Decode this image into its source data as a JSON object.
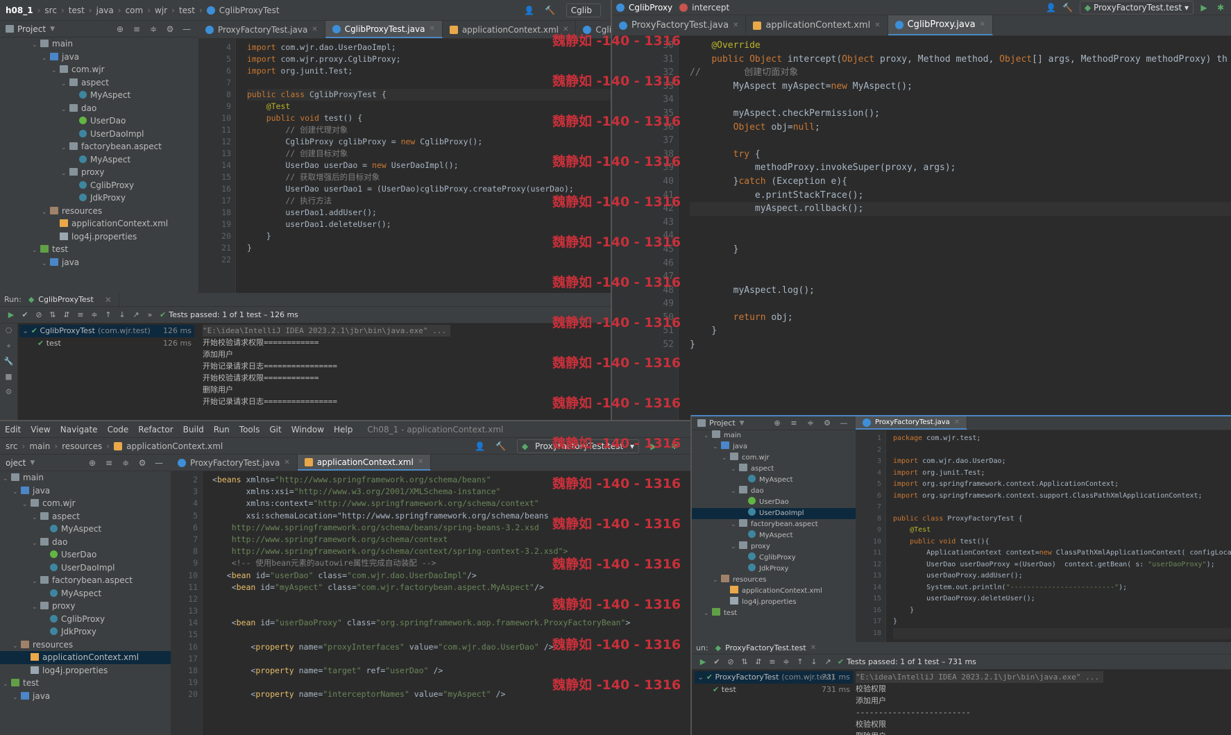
{
  "watermark": "魏静如 -140 - 1316",
  "pane_tl": {
    "breadcrumbs": [
      "h08_1",
      "src",
      "test",
      "java",
      "com",
      "wjr",
      "test",
      "CglibProxyTest"
    ],
    "run_config": "Cglib",
    "tabs": [
      {
        "label": "ProxyFactoryTest.java",
        "kind": "java",
        "active": false
      },
      {
        "label": "CglibProxyTest.java",
        "kind": "java",
        "active": true
      },
      {
        "label": "applicationContext.xml",
        "kind": "xml",
        "active": false
      },
      {
        "label": "CglibProxy.java",
        "kind": "java",
        "active": false
      }
    ],
    "tree_title": "Project",
    "tree": [
      {
        "label": "main",
        "depth": 3,
        "type": "folder",
        "open": true
      },
      {
        "label": "java",
        "depth": 4,
        "type": "src",
        "open": true
      },
      {
        "label": "com.wjr",
        "depth": 5,
        "type": "folder",
        "open": true
      },
      {
        "label": "aspect",
        "depth": 6,
        "type": "folder",
        "open": true
      },
      {
        "label": "MyAspect",
        "depth": 7,
        "type": "cls"
      },
      {
        "label": "dao",
        "depth": 6,
        "type": "folder",
        "open": true
      },
      {
        "label": "UserDao",
        "depth": 7,
        "type": "intf"
      },
      {
        "label": "UserDaoImpl",
        "depth": 7,
        "type": "cls"
      },
      {
        "label": "factorybean.aspect",
        "depth": 6,
        "type": "folder",
        "open": true
      },
      {
        "label": "MyAspect",
        "depth": 7,
        "type": "cls"
      },
      {
        "label": "proxy",
        "depth": 6,
        "type": "folder",
        "open": true
      },
      {
        "label": "CglibProxy",
        "depth": 7,
        "type": "cls"
      },
      {
        "label": "JdkProxy",
        "depth": 7,
        "type": "cls"
      },
      {
        "label": "resources",
        "depth": 4,
        "type": "res",
        "open": true
      },
      {
        "label": "applicationContext.xml",
        "depth": 5,
        "type": "xml"
      },
      {
        "label": "log4j.properties",
        "depth": 5,
        "type": "prop"
      },
      {
        "label": "test",
        "depth": 3,
        "type": "test",
        "open": true
      },
      {
        "label": "java",
        "depth": 4,
        "type": "src",
        "open": true
      }
    ],
    "line_numbers": [
      "4",
      "5",
      "6",
      "7",
      "8",
      "9",
      "10",
      "11",
      "12",
      "13",
      "14",
      "15",
      "16",
      "17",
      "18",
      "19",
      "20",
      "21",
      "22"
    ],
    "code": [
      "import com.wjr.dao.UserDaoImpl;",
      "import com.wjr.proxy.CglibProxy;",
      "import org.junit.Test;",
      "",
      "public class CglibProxyTest {",
      "    @Test",
      "    public void test() {",
      "        // 创建代理对象",
      "        CglibProxy cglibProxy = new CglibProxy();",
      "        // 创建目标对象",
      "        UserDao userDao = new UserDaoImpl();",
      "        // 获取增强后的目标对象",
      "        UserDao userDao1 = (UserDao)cglibProxy.createProxy(userDao);",
      "        // 执行方法",
      "        userDao1.addUser();",
      "        userDao1.deleteUser();",
      "    }",
      "}",
      ""
    ],
    "run": {
      "label": "Run:",
      "tab": "CglibProxyTest",
      "status": "Tests passed: 1 of 1 test – 126 ms",
      "tests": [
        {
          "label": "CglibProxyTest",
          "pkg": "(com.wjr.test)",
          "dur": "126 ms"
        },
        {
          "label": "test",
          "pkg": "",
          "dur": "126 ms"
        }
      ],
      "console": [
        "\"E:\\idea\\IntelliJ IDEA 2023.2.1\\jbr\\bin\\java.exe\" ...",
        "开始校验请求权限============",
        "添加用户",
        "开始记录请求日志================",
        "开始校验请求权限============",
        "删除用户",
        "开始记录请求日志================"
      ]
    }
  },
  "pane_tr": {
    "title": "CglibProxy",
    "method": "intercept",
    "run_config": "ProxyFactoryTest.test",
    "tabs": [
      {
        "label": "ProxyFactoryTest.java",
        "kind": "java",
        "active": false
      },
      {
        "label": "applicationContext.xml",
        "kind": "xml",
        "active": false
      },
      {
        "label": "CglibProxy.java",
        "kind": "java",
        "active": true
      }
    ],
    "line_numbers": [
      "30",
      "31",
      "32",
      "33",
      "34",
      "35",
      "36",
      "37",
      "38",
      "39",
      "40",
      "41",
      "42",
      "43",
      "44",
      "45",
      "46",
      "47",
      "48",
      "49",
      "50",
      "51",
      "52"
    ],
    "code": [
      "    @Override",
      "    public Object intercept(Object proxy, Method method, Object[] args, MethodProxy methodProxy) th",
      "//        创建切面对象",
      "        MyAspect myAspect=new MyAspect();",
      "",
      "        myAspect.checkPermission();",
      "        Object obj=null;",
      "",
      "        try {",
      "            methodProxy.invokeSuper(proxy, args);",
      "        }catch (Exception e){",
      "            e.printStackTrace();",
      "            myAspect.rollback();",
      "",
      "",
      "        }",
      "",
      "",
      "        myAspect.log();",
      "",
      "        return obj;",
      "    }",
      "}"
    ]
  },
  "pane_bl": {
    "menu": [
      "Edit",
      "View",
      "Navigate",
      "Code",
      "Refactor",
      "Build",
      "Run",
      "Tools",
      "Git",
      "Window",
      "Help"
    ],
    "project_title": "Ch08_1 - applicationContext.xml",
    "breadcrumbs": [
      "src",
      "main",
      "resources",
      "applicationContext.xml"
    ],
    "run_config": "ProxyFactoryTest.test",
    "tabs": [
      {
        "label": "ProxyFactoryTest.java",
        "kind": "java",
        "active": false
      },
      {
        "label": "applicationContext.xml",
        "kind": "xml",
        "active": true
      }
    ],
    "tree_title": "oject",
    "tree": [
      {
        "label": "main",
        "depth": 0,
        "type": "folder",
        "open": true
      },
      {
        "label": "java",
        "depth": 1,
        "type": "src",
        "open": true
      },
      {
        "label": "com.wjr",
        "depth": 2,
        "type": "folder",
        "open": true
      },
      {
        "label": "aspect",
        "depth": 3,
        "type": "folder",
        "open": true
      },
      {
        "label": "MyAspect",
        "depth": 4,
        "type": "cls"
      },
      {
        "label": "dao",
        "depth": 3,
        "type": "folder",
        "open": true
      },
      {
        "label": "UserDao",
        "depth": 4,
        "type": "intf"
      },
      {
        "label": "UserDaoImpl",
        "depth": 4,
        "type": "cls"
      },
      {
        "label": "factorybean.aspect",
        "depth": 3,
        "type": "folder",
        "open": true
      },
      {
        "label": "MyAspect",
        "depth": 4,
        "type": "cls"
      },
      {
        "label": "proxy",
        "depth": 3,
        "type": "folder",
        "open": true
      },
      {
        "label": "CglibProxy",
        "depth": 4,
        "type": "cls"
      },
      {
        "label": "JdkProxy",
        "depth": 4,
        "type": "cls"
      },
      {
        "label": "resources",
        "depth": 1,
        "type": "res",
        "open": true
      },
      {
        "label": "applicationContext.xml",
        "depth": 2,
        "type": "xml",
        "selected": true
      },
      {
        "label": "log4j.properties",
        "depth": 2,
        "type": "prop"
      },
      {
        "label": "test",
        "depth": 0,
        "type": "test",
        "open": true
      },
      {
        "label": "java",
        "depth": 1,
        "type": "src",
        "open": true
      }
    ],
    "line_numbers": [
      "2",
      "3",
      "4",
      "5",
      "6",
      "7",
      "8",
      "9",
      "10",
      "11",
      "12",
      "13",
      "14",
      "15",
      "16",
      "17",
      "18",
      "19",
      "20"
    ],
    "code": [
      "<beans xmlns=\"http://www.springframework.org/schema/beans\"",
      "       xmlns:xsi=\"http://www.w3.org/2001/XMLSchema-instance\"",
      "       xmlns:context=\"http://www.springframework.org/schema/context\"",
      "       xsi:schemaLocation=\"http://www.springframework.org/schema/beans",
      "    http://www.springframework.org/schema/beans/spring-beans-3.2.xsd",
      "    http://www.springframework.org/schema/context",
      "    http://www.springframework.org/schema/context/spring-context-3.2.xsd\">",
      "    <!-- 使用bean元素的autowire属性完成自动装配 -->",
      "   <bean id=\"userDao\" class=\"com.wjr.dao.UserDaoImpl\"/>",
      "    <bean id=\"myAspect\" class=\"com.wjr.factorybean.aspect.MyAspect\"/>",
      "",
      "",
      "    <bean id=\"userDaoProxy\" class=\"org.springframework.aop.framework.ProxyFactoryBean\">",
      "",
      "        <property name=\"proxyInterfaces\" value=\"com.wjr.dao.UserDao\" />",
      "",
      "        <property name=\"target\" ref=\"userDao\" />",
      "",
      "        <property name=\"interceptorNames\" value=\"myAspect\" />"
    ]
  },
  "pane_br": {
    "tree_title": "Project",
    "tabs": [
      {
        "label": "ProxyFactoryTest.java",
        "kind": "java",
        "active": true
      }
    ],
    "tree": [
      {
        "label": "main",
        "depth": 1,
        "type": "folder",
        "open": true
      },
      {
        "label": "java",
        "depth": 2,
        "type": "src",
        "open": true
      },
      {
        "label": "com.wjr",
        "depth": 3,
        "type": "folder",
        "open": true
      },
      {
        "label": "aspect",
        "depth": 4,
        "type": "folder",
        "open": true
      },
      {
        "label": "MyAspect",
        "depth": 5,
        "type": "cls"
      },
      {
        "label": "dao",
        "depth": 4,
        "type": "folder",
        "open": true
      },
      {
        "label": "UserDao",
        "depth": 5,
        "type": "intf"
      },
      {
        "label": "UserDaoImpl",
        "depth": 5,
        "type": "cls",
        "selected": true
      },
      {
        "label": "factorybean.aspect",
        "depth": 4,
        "type": "folder",
        "open": true
      },
      {
        "label": "MyAspect",
        "depth": 5,
        "type": "cls"
      },
      {
        "label": "proxy",
        "depth": 4,
        "type": "folder",
        "open": true
      },
      {
        "label": "CglibProxy",
        "depth": 5,
        "type": "cls"
      },
      {
        "label": "JdkProxy",
        "depth": 5,
        "type": "cls"
      },
      {
        "label": "resources",
        "depth": 2,
        "type": "res",
        "open": true
      },
      {
        "label": "applicationContext.xml",
        "depth": 3,
        "type": "xml"
      },
      {
        "label": "log4j.properties",
        "depth": 3,
        "type": "prop"
      },
      {
        "label": "test",
        "depth": 1,
        "type": "test",
        "open": true
      }
    ],
    "line_numbers": [
      "1",
      "2",
      "3",
      "4",
      "5",
      "6",
      "7",
      "8",
      "9",
      "10",
      "11",
      "12",
      "13",
      "14",
      "15",
      "16",
      "17",
      "18"
    ],
    "code": [
      "package com.wjr.test;",
      "",
      "import com.wjr.dao.UserDao;",
      "import org.junit.Test;",
      "import org.springframework.context.ApplicationContext;",
      "import org.springframework.context.support.ClassPathXmlApplicationContext;",
      "",
      "public class ProxyFactoryTest {",
      "    @Test",
      "    public void test(){",
      "        ApplicationContext context=new ClassPathXmlApplicationContext( configLocation:",
      "        UserDao userDaoProxy =(UserDao)  context.getBean( s: \"userDaoProxy\");",
      "        userDaoProxy.addUser();",
      "        System.out.println(\"-------------------------\");",
      "        userDaoProxy.deleteUser();",
      "    }",
      "}",
      ""
    ],
    "run": {
      "label": "un:",
      "tab": "ProxyFactoryTest.test",
      "status": "Tests passed: 1 of 1 test – 731 ms",
      "tests": [
        {
          "label": "ProxyFactoryTest",
          "pkg": "(com.wjr.test)",
          "dur": "731 ms"
        },
        {
          "label": "test",
          "pkg": "",
          "dur": "731 ms"
        }
      ],
      "console": [
        "\"E:\\idea\\IntelliJ IDEA 2023.2.1\\jbr\\bin\\java.exe\" ...",
        "校验权限",
        "添加用户",
        "-------------------------",
        "校验权限",
        "删除用户"
      ]
    }
  }
}
